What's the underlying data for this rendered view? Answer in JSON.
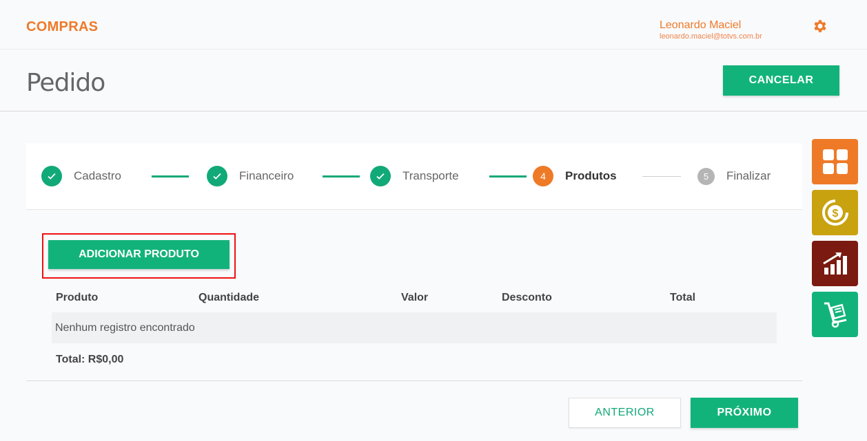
{
  "header": {
    "brand": "COMPRAS",
    "user_name": "Leonardo Maciel",
    "user_email": "leonardo.maciel@totvs.com.br",
    "settings_icon": "gear-icon"
  },
  "page": {
    "title": "Pedido",
    "cancel_label": "CANCELAR"
  },
  "stepper": {
    "steps": [
      {
        "number": "1",
        "label": "Cadastro",
        "state": "done"
      },
      {
        "number": "2",
        "label": "Financeiro",
        "state": "done"
      },
      {
        "number": "3",
        "label": "Transporte",
        "state": "done"
      },
      {
        "number": "4",
        "label": "Produtos",
        "state": "active"
      },
      {
        "number": "5",
        "label": "Finalizar",
        "state": "pending"
      }
    ]
  },
  "products": {
    "add_label": "ADICIONAR PRODUTO",
    "columns": [
      "Produto",
      "Quantidade",
      "Valor",
      "Desconto",
      "Total"
    ],
    "empty_message": "Nenhum registro encontrado",
    "total_label": "Total: R$0,00"
  },
  "footer": {
    "previous_label": "ANTERIOR",
    "next_label": "PRÓXIMO"
  },
  "side_menu": [
    {
      "icon": "dashboard-grid-icon",
      "color": "#ee7a28"
    },
    {
      "icon": "money-cycle-icon",
      "color": "#c9a210"
    },
    {
      "icon": "growth-chart-icon",
      "color": "#7a1a10"
    },
    {
      "icon": "hand-truck-icon",
      "color": "#12b37b"
    }
  ],
  "colors": {
    "accent": "#12b37b",
    "brand": "#ee7a28",
    "highlight_border": "#e11111"
  }
}
